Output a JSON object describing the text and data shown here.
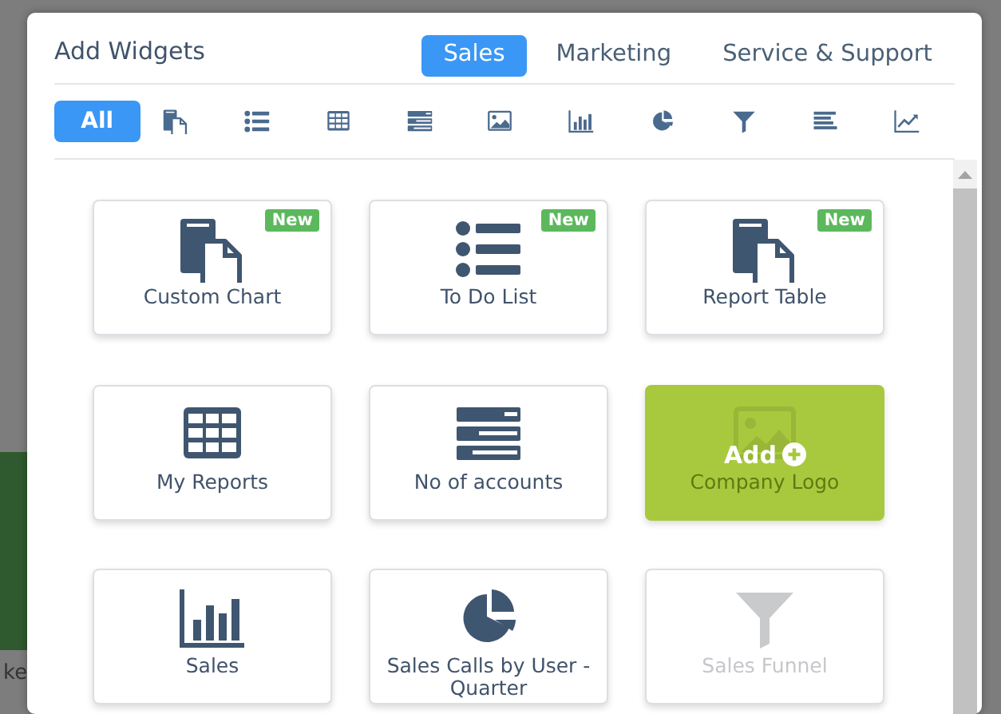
{
  "background": {
    "text_fragment": "ke"
  },
  "dialog": {
    "title": "Add Widgets",
    "tabs": [
      {
        "label": "Sales",
        "selected": true
      },
      {
        "label": "Marketing",
        "selected": false
      },
      {
        "label": "Service & Support",
        "selected": false
      }
    ],
    "filters": [
      {
        "kind": "text",
        "label": "All",
        "selected": true
      },
      {
        "kind": "document",
        "selected": false
      },
      {
        "kind": "list",
        "selected": false
      },
      {
        "kind": "table",
        "selected": false
      },
      {
        "kind": "stack",
        "selected": false
      },
      {
        "kind": "image",
        "selected": false
      },
      {
        "kind": "bars",
        "selected": false
      },
      {
        "kind": "pie",
        "selected": false
      },
      {
        "kind": "funnel",
        "selected": false
      },
      {
        "kind": "lines",
        "selected": false
      },
      {
        "kind": "line-chart",
        "selected": false
      }
    ],
    "widgets": [
      {
        "kind": "document",
        "label": "Custom Chart",
        "badge": "New",
        "disabled": false
      },
      {
        "kind": "list",
        "label": "To Do List",
        "badge": "New",
        "disabled": false
      },
      {
        "kind": "document",
        "label": "Report Table",
        "badge": "New",
        "disabled": false
      },
      {
        "kind": "table",
        "label": "My Reports",
        "disabled": false
      },
      {
        "kind": "stack",
        "label": "No of accounts",
        "disabled": false
      },
      {
        "kind": "image",
        "label": "Company Logo",
        "overlay": "Add",
        "disabled": false
      },
      {
        "kind": "bars",
        "label": "Sales",
        "disabled": false
      },
      {
        "kind": "pie",
        "label": "Sales Calls by User - Quarter",
        "disabled": false
      },
      {
        "kind": "funnel",
        "label": "Sales Funnel",
        "disabled": true
      }
    ]
  }
}
